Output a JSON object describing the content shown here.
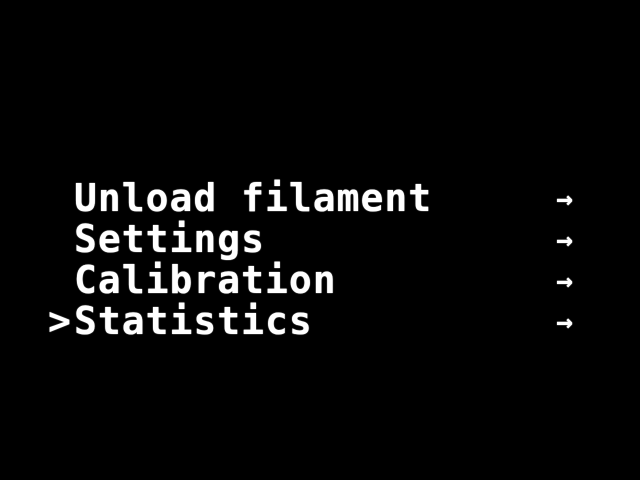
{
  "screen": {
    "background": "#000000",
    "foreground": "#ffffff"
  },
  "menu": {
    "selected_index": 3,
    "cursor_glyph": ">",
    "arrow_glyph": "→",
    "items": [
      {
        "label": "Unload filament",
        "suffix": "",
        "icon": "arrow-right-icon"
      },
      {
        "label": "Settings",
        "suffix": "",
        "icon": "arrow-right-icon"
      },
      {
        "label": "Calibration",
        "suffix": "",
        "icon": "arrow-right-icon"
      },
      {
        "label": "Statistics",
        "suffix": "",
        "icon": "arrow-right-icon"
      }
    ]
  }
}
